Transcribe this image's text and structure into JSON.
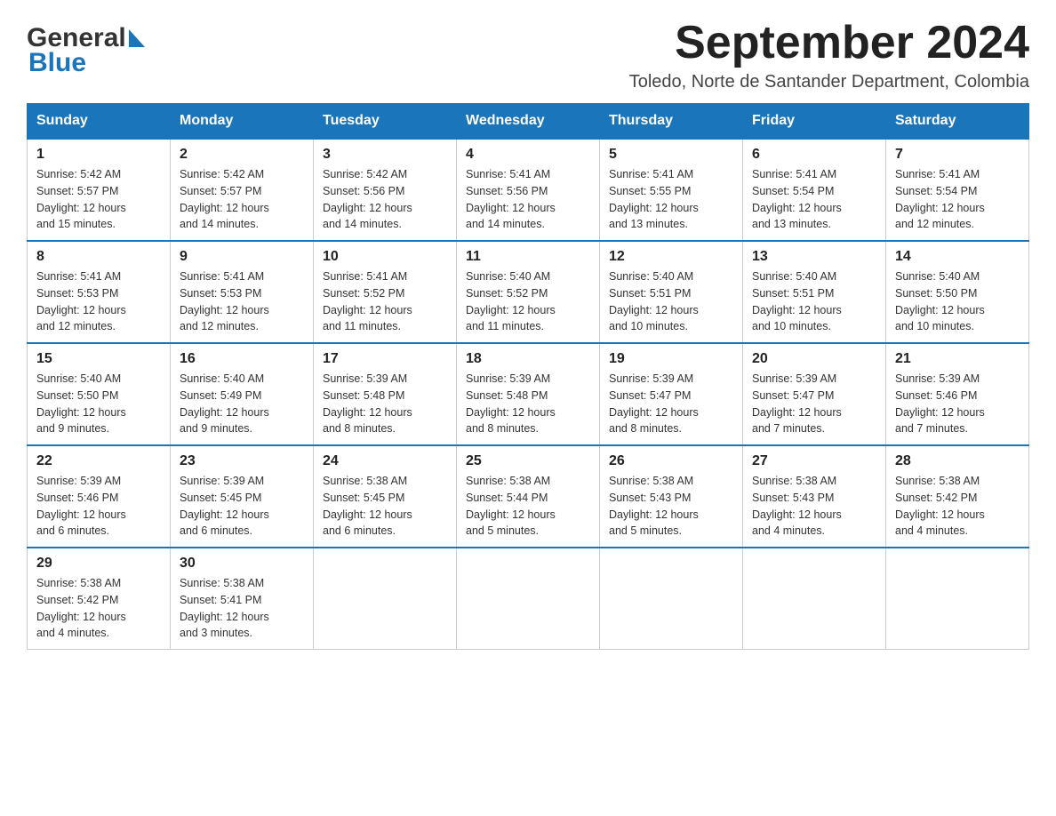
{
  "header": {
    "title": "September 2024",
    "subtitle": "Toledo, Norte de Santander Department, Colombia"
  },
  "logo": {
    "part1": "General",
    "part2": "Blue"
  },
  "weekdays": [
    "Sunday",
    "Monday",
    "Tuesday",
    "Wednesday",
    "Thursday",
    "Friday",
    "Saturday"
  ],
  "weeks": [
    [
      {
        "day": "1",
        "sunrise": "5:42 AM",
        "sunset": "5:57 PM",
        "daylight": "12 hours and 15 minutes."
      },
      {
        "day": "2",
        "sunrise": "5:42 AM",
        "sunset": "5:57 PM",
        "daylight": "12 hours and 14 minutes."
      },
      {
        "day": "3",
        "sunrise": "5:42 AM",
        "sunset": "5:56 PM",
        "daylight": "12 hours and 14 minutes."
      },
      {
        "day": "4",
        "sunrise": "5:41 AM",
        "sunset": "5:56 PM",
        "daylight": "12 hours and 14 minutes."
      },
      {
        "day": "5",
        "sunrise": "5:41 AM",
        "sunset": "5:55 PM",
        "daylight": "12 hours and 13 minutes."
      },
      {
        "day": "6",
        "sunrise": "5:41 AM",
        "sunset": "5:54 PM",
        "daylight": "12 hours and 13 minutes."
      },
      {
        "day": "7",
        "sunrise": "5:41 AM",
        "sunset": "5:54 PM",
        "daylight": "12 hours and 12 minutes."
      }
    ],
    [
      {
        "day": "8",
        "sunrise": "5:41 AM",
        "sunset": "5:53 PM",
        "daylight": "12 hours and 12 minutes."
      },
      {
        "day": "9",
        "sunrise": "5:41 AM",
        "sunset": "5:53 PM",
        "daylight": "12 hours and 12 minutes."
      },
      {
        "day": "10",
        "sunrise": "5:41 AM",
        "sunset": "5:52 PM",
        "daylight": "12 hours and 11 minutes."
      },
      {
        "day": "11",
        "sunrise": "5:40 AM",
        "sunset": "5:52 PM",
        "daylight": "12 hours and 11 minutes."
      },
      {
        "day": "12",
        "sunrise": "5:40 AM",
        "sunset": "5:51 PM",
        "daylight": "12 hours and 10 minutes."
      },
      {
        "day": "13",
        "sunrise": "5:40 AM",
        "sunset": "5:51 PM",
        "daylight": "12 hours and 10 minutes."
      },
      {
        "day": "14",
        "sunrise": "5:40 AM",
        "sunset": "5:50 PM",
        "daylight": "12 hours and 10 minutes."
      }
    ],
    [
      {
        "day": "15",
        "sunrise": "5:40 AM",
        "sunset": "5:50 PM",
        "daylight": "12 hours and 9 minutes."
      },
      {
        "day": "16",
        "sunrise": "5:40 AM",
        "sunset": "5:49 PM",
        "daylight": "12 hours and 9 minutes."
      },
      {
        "day": "17",
        "sunrise": "5:39 AM",
        "sunset": "5:48 PM",
        "daylight": "12 hours and 8 minutes."
      },
      {
        "day": "18",
        "sunrise": "5:39 AM",
        "sunset": "5:48 PM",
        "daylight": "12 hours and 8 minutes."
      },
      {
        "day": "19",
        "sunrise": "5:39 AM",
        "sunset": "5:47 PM",
        "daylight": "12 hours and 8 minutes."
      },
      {
        "day": "20",
        "sunrise": "5:39 AM",
        "sunset": "5:47 PM",
        "daylight": "12 hours and 7 minutes."
      },
      {
        "day": "21",
        "sunrise": "5:39 AM",
        "sunset": "5:46 PM",
        "daylight": "12 hours and 7 minutes."
      }
    ],
    [
      {
        "day": "22",
        "sunrise": "5:39 AM",
        "sunset": "5:46 PM",
        "daylight": "12 hours and 6 minutes."
      },
      {
        "day": "23",
        "sunrise": "5:39 AM",
        "sunset": "5:45 PM",
        "daylight": "12 hours and 6 minutes."
      },
      {
        "day": "24",
        "sunrise": "5:38 AM",
        "sunset": "5:45 PM",
        "daylight": "12 hours and 6 minutes."
      },
      {
        "day": "25",
        "sunrise": "5:38 AM",
        "sunset": "5:44 PM",
        "daylight": "12 hours and 5 minutes."
      },
      {
        "day": "26",
        "sunrise": "5:38 AM",
        "sunset": "5:43 PM",
        "daylight": "12 hours and 5 minutes."
      },
      {
        "day": "27",
        "sunrise": "5:38 AM",
        "sunset": "5:43 PM",
        "daylight": "12 hours and 4 minutes."
      },
      {
        "day": "28",
        "sunrise": "5:38 AM",
        "sunset": "5:42 PM",
        "daylight": "12 hours and 4 minutes."
      }
    ],
    [
      {
        "day": "29",
        "sunrise": "5:38 AM",
        "sunset": "5:42 PM",
        "daylight": "12 hours and 4 minutes."
      },
      {
        "day": "30",
        "sunrise": "5:38 AM",
        "sunset": "5:41 PM",
        "daylight": "12 hours and 3 minutes."
      },
      null,
      null,
      null,
      null,
      null
    ]
  ]
}
